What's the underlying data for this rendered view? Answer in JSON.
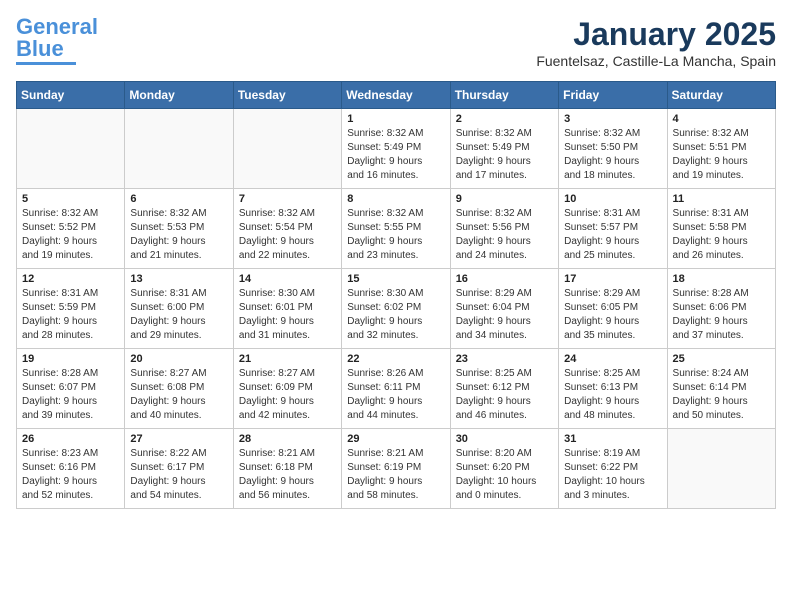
{
  "header": {
    "logo_line1": "General",
    "logo_line2": "Blue",
    "title": "January 2025",
    "subtitle": "Fuentelsaz, Castille-La Mancha, Spain"
  },
  "weekdays": [
    "Sunday",
    "Monday",
    "Tuesday",
    "Wednesday",
    "Thursday",
    "Friday",
    "Saturday"
  ],
  "weeks": [
    [
      {
        "day": "",
        "info": ""
      },
      {
        "day": "",
        "info": ""
      },
      {
        "day": "",
        "info": ""
      },
      {
        "day": "1",
        "info": "Sunrise: 8:32 AM\nSunset: 5:49 PM\nDaylight: 9 hours\nand 16 minutes."
      },
      {
        "day": "2",
        "info": "Sunrise: 8:32 AM\nSunset: 5:49 PM\nDaylight: 9 hours\nand 17 minutes."
      },
      {
        "day": "3",
        "info": "Sunrise: 8:32 AM\nSunset: 5:50 PM\nDaylight: 9 hours\nand 18 minutes."
      },
      {
        "day": "4",
        "info": "Sunrise: 8:32 AM\nSunset: 5:51 PM\nDaylight: 9 hours\nand 19 minutes."
      }
    ],
    [
      {
        "day": "5",
        "info": "Sunrise: 8:32 AM\nSunset: 5:52 PM\nDaylight: 9 hours\nand 19 minutes."
      },
      {
        "day": "6",
        "info": "Sunrise: 8:32 AM\nSunset: 5:53 PM\nDaylight: 9 hours\nand 21 minutes."
      },
      {
        "day": "7",
        "info": "Sunrise: 8:32 AM\nSunset: 5:54 PM\nDaylight: 9 hours\nand 22 minutes."
      },
      {
        "day": "8",
        "info": "Sunrise: 8:32 AM\nSunset: 5:55 PM\nDaylight: 9 hours\nand 23 minutes."
      },
      {
        "day": "9",
        "info": "Sunrise: 8:32 AM\nSunset: 5:56 PM\nDaylight: 9 hours\nand 24 minutes."
      },
      {
        "day": "10",
        "info": "Sunrise: 8:31 AM\nSunset: 5:57 PM\nDaylight: 9 hours\nand 25 minutes."
      },
      {
        "day": "11",
        "info": "Sunrise: 8:31 AM\nSunset: 5:58 PM\nDaylight: 9 hours\nand 26 minutes."
      }
    ],
    [
      {
        "day": "12",
        "info": "Sunrise: 8:31 AM\nSunset: 5:59 PM\nDaylight: 9 hours\nand 28 minutes."
      },
      {
        "day": "13",
        "info": "Sunrise: 8:31 AM\nSunset: 6:00 PM\nDaylight: 9 hours\nand 29 minutes."
      },
      {
        "day": "14",
        "info": "Sunrise: 8:30 AM\nSunset: 6:01 PM\nDaylight: 9 hours\nand 31 minutes."
      },
      {
        "day": "15",
        "info": "Sunrise: 8:30 AM\nSunset: 6:02 PM\nDaylight: 9 hours\nand 32 minutes."
      },
      {
        "day": "16",
        "info": "Sunrise: 8:29 AM\nSunset: 6:04 PM\nDaylight: 9 hours\nand 34 minutes."
      },
      {
        "day": "17",
        "info": "Sunrise: 8:29 AM\nSunset: 6:05 PM\nDaylight: 9 hours\nand 35 minutes."
      },
      {
        "day": "18",
        "info": "Sunrise: 8:28 AM\nSunset: 6:06 PM\nDaylight: 9 hours\nand 37 minutes."
      }
    ],
    [
      {
        "day": "19",
        "info": "Sunrise: 8:28 AM\nSunset: 6:07 PM\nDaylight: 9 hours\nand 39 minutes."
      },
      {
        "day": "20",
        "info": "Sunrise: 8:27 AM\nSunset: 6:08 PM\nDaylight: 9 hours\nand 40 minutes."
      },
      {
        "day": "21",
        "info": "Sunrise: 8:27 AM\nSunset: 6:09 PM\nDaylight: 9 hours\nand 42 minutes."
      },
      {
        "day": "22",
        "info": "Sunrise: 8:26 AM\nSunset: 6:11 PM\nDaylight: 9 hours\nand 44 minutes."
      },
      {
        "day": "23",
        "info": "Sunrise: 8:25 AM\nSunset: 6:12 PM\nDaylight: 9 hours\nand 46 minutes."
      },
      {
        "day": "24",
        "info": "Sunrise: 8:25 AM\nSunset: 6:13 PM\nDaylight: 9 hours\nand 48 minutes."
      },
      {
        "day": "25",
        "info": "Sunrise: 8:24 AM\nSunset: 6:14 PM\nDaylight: 9 hours\nand 50 minutes."
      }
    ],
    [
      {
        "day": "26",
        "info": "Sunrise: 8:23 AM\nSunset: 6:16 PM\nDaylight: 9 hours\nand 52 minutes."
      },
      {
        "day": "27",
        "info": "Sunrise: 8:22 AM\nSunset: 6:17 PM\nDaylight: 9 hours\nand 54 minutes."
      },
      {
        "day": "28",
        "info": "Sunrise: 8:21 AM\nSunset: 6:18 PM\nDaylight: 9 hours\nand 56 minutes."
      },
      {
        "day": "29",
        "info": "Sunrise: 8:21 AM\nSunset: 6:19 PM\nDaylight: 9 hours\nand 58 minutes."
      },
      {
        "day": "30",
        "info": "Sunrise: 8:20 AM\nSunset: 6:20 PM\nDaylight: 10 hours\nand 0 minutes."
      },
      {
        "day": "31",
        "info": "Sunrise: 8:19 AM\nSunset: 6:22 PM\nDaylight: 10 hours\nand 3 minutes."
      },
      {
        "day": "",
        "info": ""
      }
    ]
  ]
}
